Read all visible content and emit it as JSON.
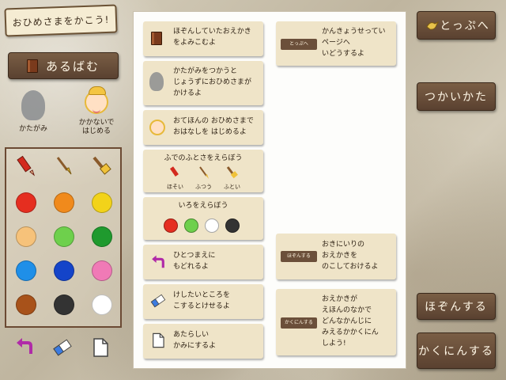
{
  "title": "おひめさまをかこう!",
  "album_label": "あるばむ",
  "silhouette_label": "かたがみ",
  "princess_label_1": "かかないで",
  "princess_label_2": "はじめる",
  "colors": [
    "#e52e20",
    "#f08a1c",
    "#f2d31a",
    "#f6c27a",
    "#6ed04c",
    "#1f9a2e",
    "#1f8fe8",
    "#1444c9",
    "#f07ab6",
    "#a8521a",
    "#333333",
    "#ffffff"
  ],
  "cards": {
    "album": {
      "l1": "ほぞんしていたおえかき",
      "l2": "をよみこむよ"
    },
    "silhouette": {
      "l1": "かたがみをつかうと",
      "l2": "じょうずにおひめさまが",
      "l3": "かけるよ"
    },
    "princess": {
      "l1": "おてほんの おひめさまで",
      "l2": "おはなしを はじめるよ"
    },
    "brush": {
      "title": "ふでのふとさをえらぼう",
      "thin": "ほそい",
      "normal": "ふつう",
      "thick": "ふとい"
    },
    "color": {
      "title": "いろをえらぼう",
      "dots": [
        "#e52e20",
        "#6ed04c",
        "#ffffff",
        "#333333"
      ]
    },
    "undo": {
      "l1": "ひとつまえに",
      "l2": "もどれるよ"
    },
    "eraser": {
      "l1": "けしたいところを",
      "l2": "こするとけせるよ"
    },
    "newpage": {
      "l1": "あたらしい",
      "l2": "かみにするよ"
    },
    "top": {
      "mini": "とっぷへ",
      "l1": "かんきょうせってい",
      "l2": "ページへ",
      "l3": "いどうするよ"
    },
    "save": {
      "mini": "ほぞんする",
      "l1": "おきにいりの",
      "l2": "おえかきを",
      "l3": "のこしておけるよ"
    },
    "print": {
      "mini": "かくにんする",
      "l1": "おえかきが",
      "l2": "えほんのなかで",
      "l3": "どんなかんじに",
      "l4": "みえるかかくにん",
      "l5": "しよう!"
    }
  },
  "right_buttons": {
    "top": "とっぷへ",
    "howto": "つかいかた",
    "save": "ほぞんする",
    "print": "かくにんする"
  }
}
